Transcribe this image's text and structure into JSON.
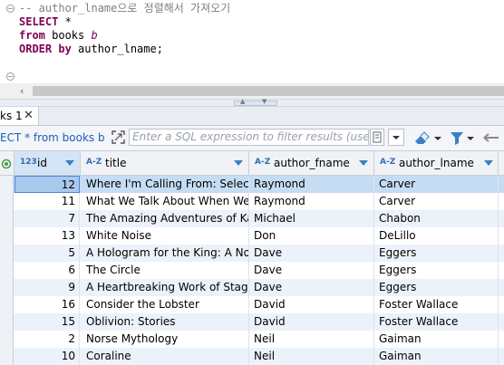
{
  "editor": {
    "comment": "-- author_lname으로 정렬해서 가져오기",
    "line1_kw": "SELECT",
    "line1_rest": " *",
    "line2_kw": "from",
    "line2_table": " books ",
    "line2_alias": "b",
    "line3_kw": "ORDER by",
    "line3_rest": " author_lname;"
  },
  "results_tab": {
    "label": "ks 1",
    "close": "✕"
  },
  "filter": {
    "query_chip": "ECT * from books b (",
    "placeholder": "Enter a SQL expression to filter results (use Ctrl+"
  },
  "grid": {
    "columns": [
      {
        "type": "123",
        "name": "id"
      },
      {
        "type": "A-Z",
        "name": "title"
      },
      {
        "type": "A-Z",
        "name": "author_fname"
      },
      {
        "type": "A-Z",
        "name": "author_lname"
      }
    ],
    "rows": [
      {
        "id": "12",
        "title": "Where I'm Calling From: Selected",
        "author_fname": "Raymond",
        "author_lname": "Carver"
      },
      {
        "id": "11",
        "title": "What We Talk About When We Tal",
        "author_fname": "Raymond",
        "author_lname": "Carver"
      },
      {
        "id": "7",
        "title": "The Amazing Adventures of Kavali",
        "author_fname": "Michael",
        "author_lname": "Chabon"
      },
      {
        "id": "13",
        "title": "White Noise",
        "author_fname": "Don",
        "author_lname": "DeLillo"
      },
      {
        "id": "5",
        "title": "A Hologram for the King: A Novel",
        "author_fname": "Dave",
        "author_lname": "Eggers"
      },
      {
        "id": "6",
        "title": "The Circle",
        "author_fname": "Dave",
        "author_lname": "Eggers"
      },
      {
        "id": "9",
        "title": "A Heartbreaking Work of Staggerin",
        "author_fname": "Dave",
        "author_lname": "Eggers"
      },
      {
        "id": "16",
        "title": "Consider the Lobster",
        "author_fname": "David",
        "author_lname": "Foster Wallace"
      },
      {
        "id": "15",
        "title": "Oblivion: Stories",
        "author_fname": "David",
        "author_lname": "Foster Wallace"
      },
      {
        "id": "2",
        "title": "Norse Mythology",
        "author_fname": "Neil",
        "author_lname": "Gaiman"
      },
      {
        "id": "10",
        "title": "Coraline",
        "author_fname": "Neil",
        "author_lname": "Gaiman"
      }
    ]
  },
  "colors": {
    "keyword": "#7f0055",
    "selection": "#c5dcf3",
    "accent": "#3b7fc4"
  }
}
